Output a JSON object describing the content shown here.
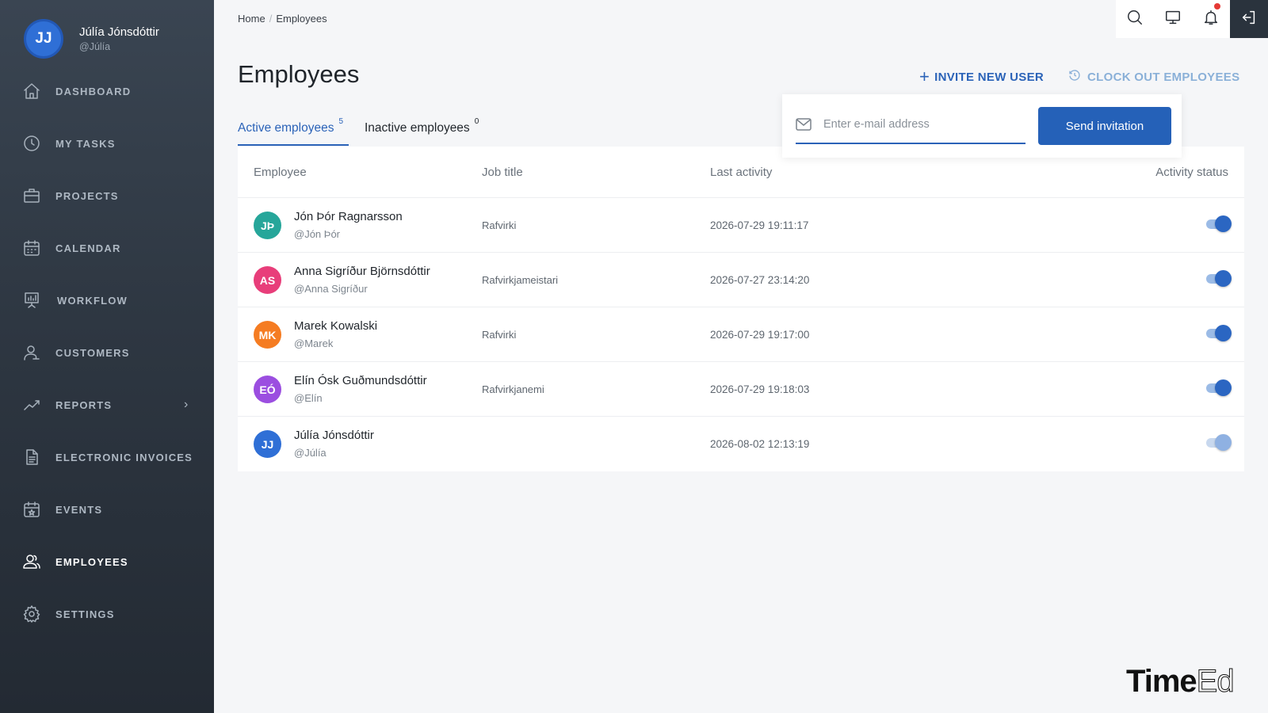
{
  "user": {
    "initials": "JJ",
    "name": "Júlía Jónsdóttir",
    "handle": "@Júlía"
  },
  "sidebar": {
    "items": [
      {
        "label": "DASHBOARD",
        "icon": "home-icon"
      },
      {
        "label": "MY TASKS",
        "icon": "clock-icon"
      },
      {
        "label": "PROJECTS",
        "icon": "briefcase-icon"
      },
      {
        "label": "CALENDAR",
        "icon": "calendar-icon"
      },
      {
        "label": "WORKFLOW",
        "icon": "presentation-chart-icon"
      },
      {
        "label": "CUSTOMERS",
        "icon": "user-icon"
      },
      {
        "label": "REPORTS",
        "icon": "trend-line-icon",
        "chevron": "›"
      },
      {
        "label": "ELECTRONIC INVOICES",
        "icon": "document-icon"
      },
      {
        "label": "EVENTS",
        "icon": "calendar-star-icon"
      },
      {
        "label": "EMPLOYEES",
        "icon": "users-icon",
        "active": true
      },
      {
        "label": "SETTINGS",
        "icon": "gear-icon"
      }
    ]
  },
  "breadcrumb": {
    "home": "Home",
    "sep": "/",
    "current": "Employees"
  },
  "header": {
    "title": "Employees",
    "invite_label": "INVITE NEW USER",
    "invite_icon": "+",
    "clockout_label": "CLOCK OUT EMPLOYEES"
  },
  "tabs": [
    {
      "label": "Active employees",
      "count": "5",
      "active": true
    },
    {
      "label": "Inactive employees",
      "count": "0",
      "active": false
    }
  ],
  "invite_popover": {
    "placeholder": "Enter e-mail address",
    "button": "Send invitation"
  },
  "table": {
    "columns": [
      "Employee",
      "Job title",
      "Last activity",
      "Activity status"
    ],
    "rows": [
      {
        "initials": "JÞ",
        "color": "#26a69a",
        "name": "Jón Þór Ragnarsson",
        "handle": "@Jón Þór",
        "job": "Rafvirki",
        "last_activity": "2026-07-29 19:11:17",
        "active": true
      },
      {
        "initials": "AS",
        "color": "#e83e7a",
        "name": "Anna Sigríður Björnsdóttir",
        "handle": "@Anna Sigríður",
        "job": "Rafvirkjameistari",
        "last_activity": "2026-07-27 23:14:20",
        "active": true
      },
      {
        "initials": "MK",
        "color": "#f57c22",
        "name": "Marek Kowalski",
        "handle": "@Marek",
        "job": "Rafvirki",
        "last_activity": "2026-07-29 19:17:00",
        "active": true
      },
      {
        "initials": "EÓ",
        "color": "#9b4ee0",
        "name": "Elín Ósk Guðmundsdóttir",
        "handle": "@Elín",
        "job": "Rafvirkjanemi",
        "last_activity": "2026-07-29 19:18:03",
        "active": true
      },
      {
        "initials": "JJ",
        "color": "#2f6fd6",
        "name": "Júlía Jónsdóttir",
        "handle": "@Júlía",
        "job": "",
        "last_activity": "2026-08-02 12:13:19",
        "active": true,
        "disabled": true
      }
    ]
  },
  "brand": {
    "logo_bold": "Time",
    "logo_light": "Ed"
  },
  "colors": {
    "accent": "#2b63b8",
    "sidebar": "#2e3742",
    "notification_dot": "#e53935"
  }
}
